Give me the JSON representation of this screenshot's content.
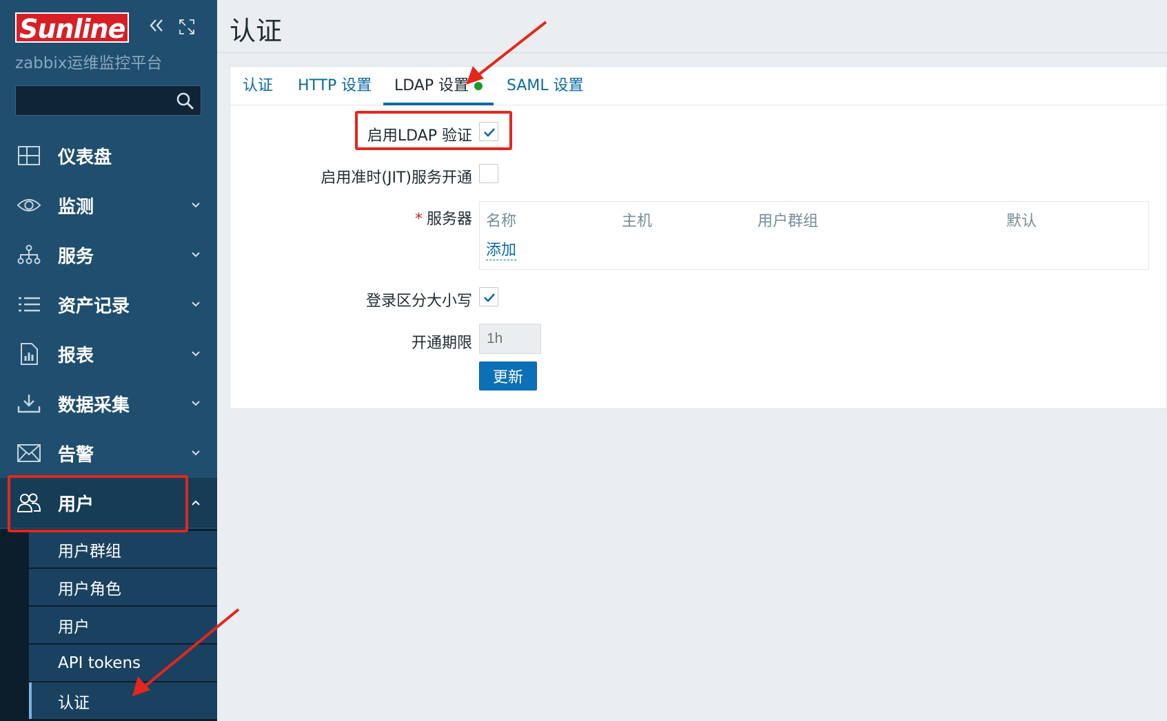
{
  "brand": {
    "logo_text": "Sunline",
    "subtitle": "zabbix运维监控平台"
  },
  "sidebar": {
    "collapse_icon": "double-chevron-left-icon",
    "kiosk_icon": "expand-icon",
    "search": {
      "value": "",
      "placeholder": "",
      "icon": "search-icon"
    },
    "menu": [
      {
        "label": "仪表盘",
        "icon": "dashboard-icon",
        "expandable": false
      },
      {
        "label": "监测",
        "icon": "eye-icon",
        "expandable": true
      },
      {
        "label": "服务",
        "icon": "hierarchy-icon",
        "expandable": true
      },
      {
        "label": "资产记录",
        "icon": "list-icon",
        "expandable": true
      },
      {
        "label": "报表",
        "icon": "report-icon",
        "expandable": true
      },
      {
        "label": "数据采集",
        "icon": "download-icon",
        "expandable": true
      },
      {
        "label": "告警",
        "icon": "envelope-icon",
        "expandable": true
      },
      {
        "label": "用户",
        "icon": "users-icon",
        "expandable": true,
        "expanded": true
      }
    ],
    "submenu": [
      {
        "label": "用户群组"
      },
      {
        "label": "用户角色"
      },
      {
        "label": "用户"
      },
      {
        "label": "API tokens"
      },
      {
        "label": "认证",
        "selected": true
      }
    ]
  },
  "page": {
    "title": "认证"
  },
  "tabs": [
    {
      "label": "认证"
    },
    {
      "label": "HTTP 设置"
    },
    {
      "label": "LDAP 设置",
      "active": true,
      "status": "enabled"
    },
    {
      "label": "SAML 设置"
    }
  ],
  "form": {
    "enable_ldap": {
      "label": "启用LDAP 验证",
      "checked": true
    },
    "enable_jit": {
      "label": "启用准时(JIT)服务开通",
      "checked": false
    },
    "servers": {
      "label": "服务器",
      "required_mark": "*",
      "columns": [
        "名称",
        "主机",
        "用户群组",
        "默认"
      ],
      "add_link": "添加"
    },
    "case_sensitive": {
      "label": "登录区分大小写",
      "checked": true
    },
    "provisioning_period": {
      "label": "开通期限",
      "value": "",
      "placeholder": "1h"
    },
    "update_button": "更新"
  },
  "colors": {
    "sidebar_bg": "#1f4e6e",
    "accent": "#0a6aa1",
    "highlight_red": "#e4261d",
    "status_green": "#1a9a2e"
  }
}
